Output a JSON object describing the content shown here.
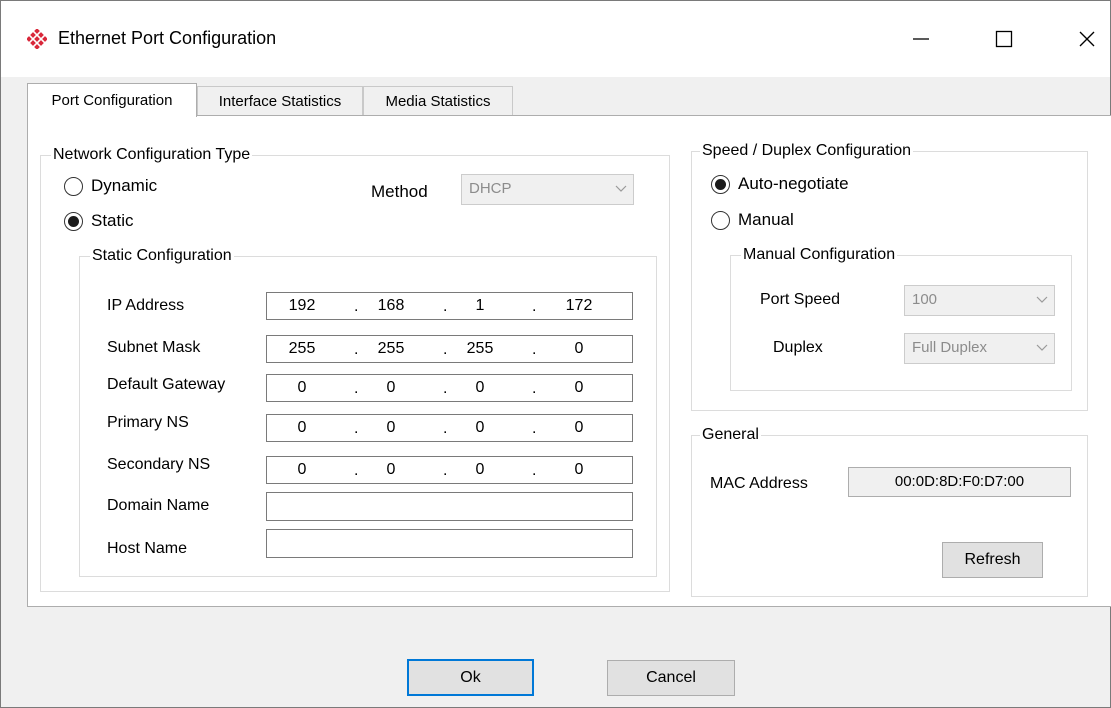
{
  "window": {
    "title": "Ethernet Port Configuration",
    "controls": [
      "minimize-icon",
      "maximize-icon",
      "close-icon"
    ]
  },
  "tabs": [
    {
      "label": "Port Configuration",
      "active": true
    },
    {
      "label": "Interface Statistics",
      "active": false
    },
    {
      "label": "Media Statistics",
      "active": false
    }
  ],
  "network": {
    "group_title": "Network Configuration Type",
    "dynamic_label": "Dynamic",
    "static_label": "Static",
    "selected": "Static",
    "method_label": "Method",
    "method_value": "DHCP",
    "static_group_title": "Static Configuration",
    "fields": {
      "ip": {
        "label": "IP Address",
        "octets": [
          "192",
          "168",
          "1",
          "172"
        ]
      },
      "subnet": {
        "label": "Subnet Mask",
        "octets": [
          "255",
          "255",
          "255",
          "0"
        ]
      },
      "gateway": {
        "label": "Default Gateway",
        "octets": [
          "0",
          "0",
          "0",
          "0"
        ]
      },
      "primary_ns": {
        "label": "Primary NS",
        "octets": [
          "0",
          "0",
          "0",
          "0"
        ]
      },
      "secondary_ns": {
        "label": "Secondary NS",
        "octets": [
          "0",
          "0",
          "0",
          "0"
        ]
      }
    },
    "domain_label": "Domain Name",
    "domain_value": "",
    "host_label": "Host Name",
    "host_value": ""
  },
  "speed": {
    "group_title": "Speed / Duplex Configuration",
    "auto_label": "Auto-negotiate",
    "manual_label": "Manual",
    "selected": "Auto-negotiate",
    "manual_group_title": "Manual Configuration",
    "port_speed_label": "Port Speed",
    "port_speed_value": "100",
    "duplex_label": "Duplex",
    "duplex_value": "Full Duplex"
  },
  "general": {
    "group_title": "General",
    "mac_label": "MAC Address",
    "mac_value": "00:0D:8D:F0:D7:00",
    "refresh_label": "Refresh"
  },
  "footer": {
    "ok_label": "Ok",
    "cancel_label": "Cancel"
  },
  "colors": {
    "accent": "#0078d7",
    "logo_red": "#d9273a"
  }
}
